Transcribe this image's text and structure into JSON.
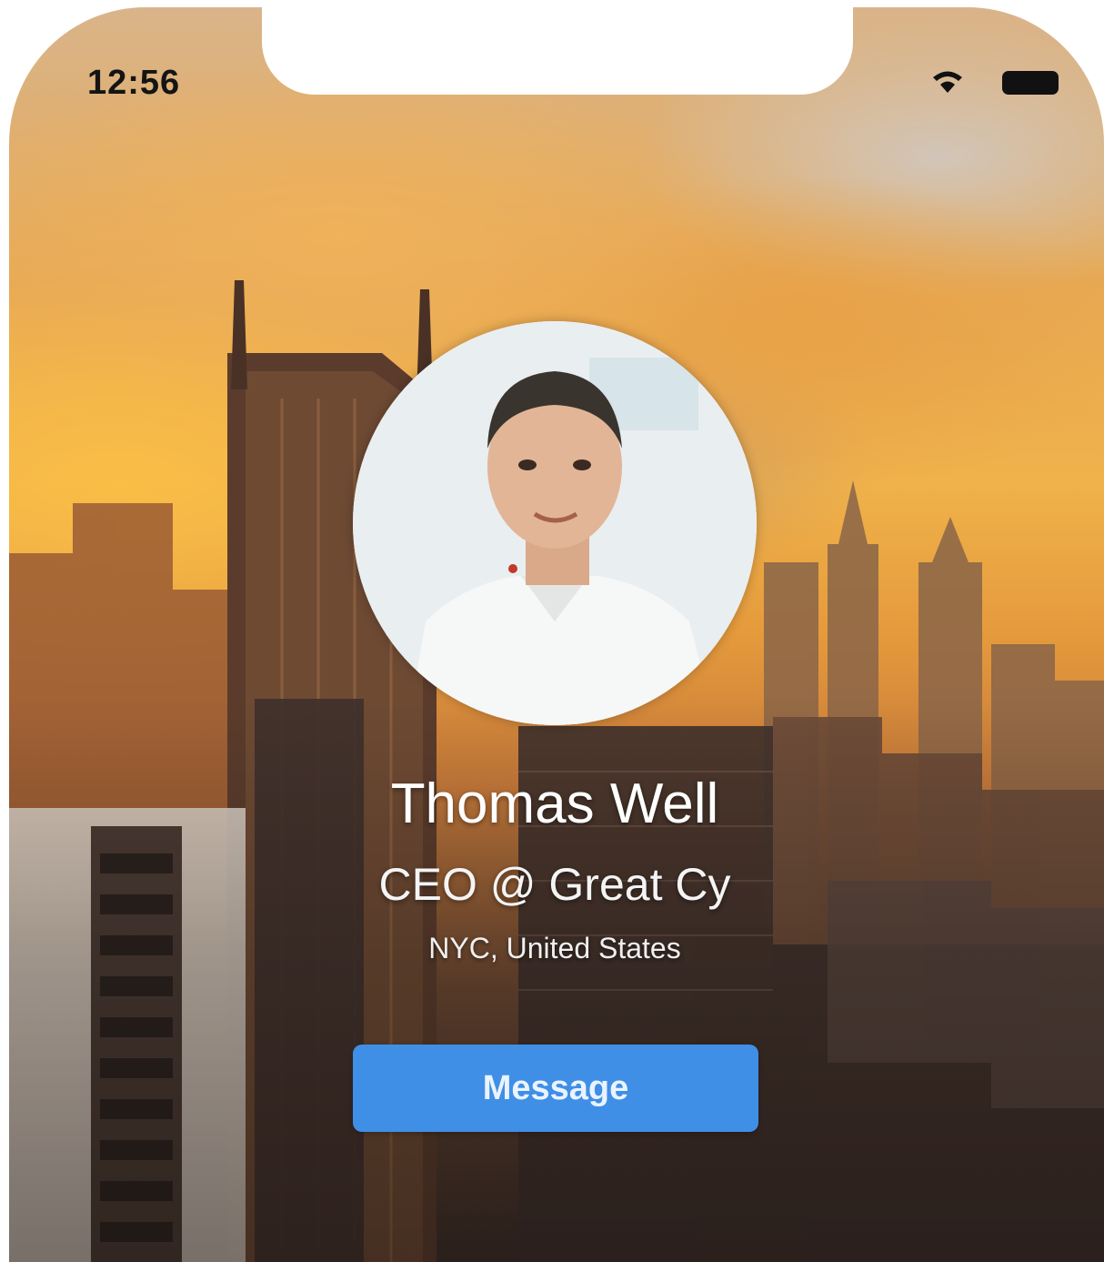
{
  "status_bar": {
    "time": "12:56",
    "icons": [
      "wifi-icon",
      "battery-icon"
    ]
  },
  "profile": {
    "name": "Thomas Well",
    "title": "CEO @ Great Cy",
    "location": "NYC, United States",
    "avatar": "profile-photo"
  },
  "actions": {
    "message_label": "Message"
  },
  "colors": {
    "accent": "#3f8fe6",
    "text_light": "#ffffff",
    "status_text": "#141414"
  }
}
